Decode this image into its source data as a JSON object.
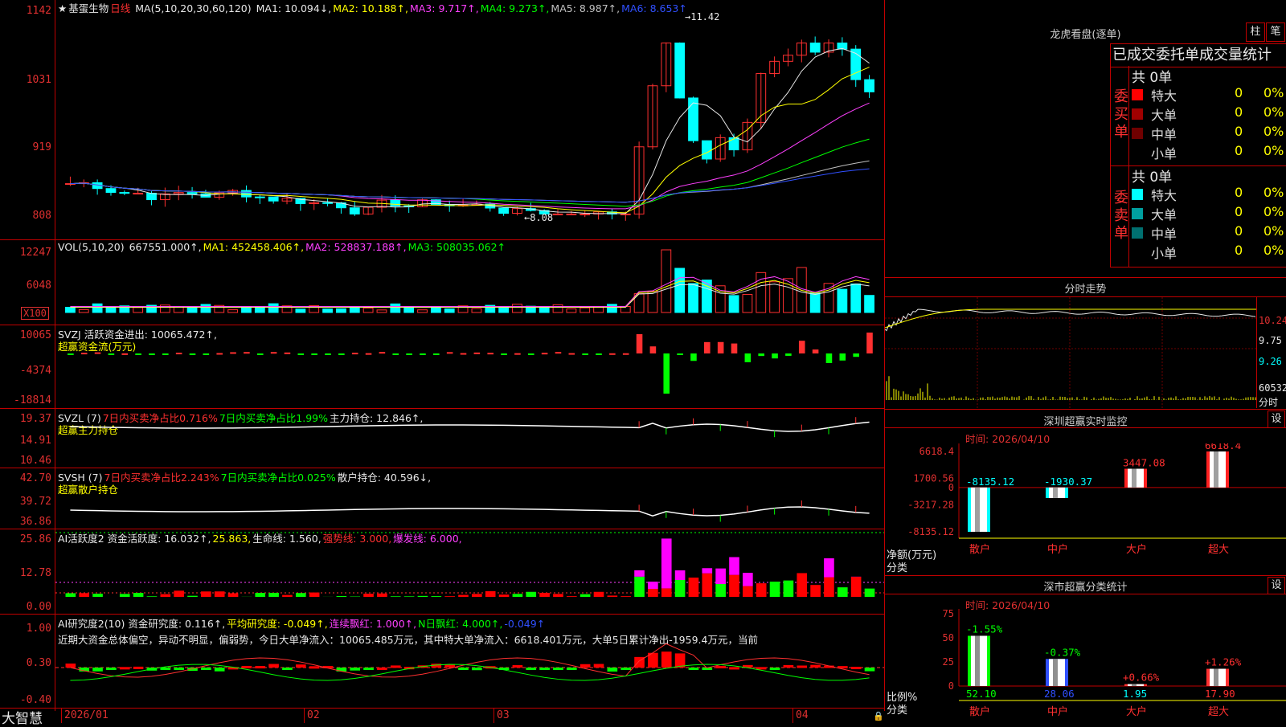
{
  "stock": {
    "star": "★",
    "name": "基蛋生物",
    "period": "日线"
  },
  "main_indicator": {
    "label": "MA(5,10,20,30,60,120)",
    "items": [
      {
        "text": "MA1: 10.094↓,",
        "color": "#e8e8e8"
      },
      {
        "text": "MA2: 10.188↑,",
        "color": "#ffff00"
      },
      {
        "text": "MA3: 9.717↑,",
        "color": "#ff40ff"
      },
      {
        "text": "MA4: 9.273↑,",
        "color": "#00ff00"
      },
      {
        "text": "MA5: 8.987↑,",
        "color": "#c0c0c0"
      },
      {
        "text": "MA6: 8.653↑",
        "color": "#3050ff"
      }
    ],
    "high_mark": "11.42",
    "low_mark": "8.08",
    "y_labels": [
      "1142",
      "1031",
      "919",
      "808"
    ]
  },
  "volume_panel": {
    "label": "VOL(5,10,20)",
    "items": [
      {
        "text": "667551.000↑,",
        "color": "#e8e8e8"
      },
      {
        "text": "MA1: 452458.406↑,",
        "color": "#ffff00"
      },
      {
        "text": "MA2: 528837.188↑,",
        "color": "#ff40ff"
      },
      {
        "text": "MA3: 508035.062↑",
        "color": "#00ff00"
      }
    ],
    "y_labels": [
      "12247",
      "6048"
    ],
    "unit_box": "X100"
  },
  "svzj_panel": {
    "line1": "SVZJ  活跃资金进出: 10065.472↑,",
    "line2": "超赢资金流(万元)",
    "y_labels": [
      "10065",
      "-4374",
      "-18814"
    ]
  },
  "svzl_panel": {
    "label": "SVZL (7)",
    "items": [
      {
        "text": "7日内买卖净占比0.716%",
        "color": "#ff3030"
      },
      {
        "text": "7日内买卖净占比1.99%",
        "color": "#00ff00"
      },
      {
        "text": "主力持仓: 12.846↑,",
        "color": "#e8e8e8"
      }
    ],
    "line2": "超赢主力持仓",
    "y_labels": [
      "19.37",
      "14.91",
      "10.46"
    ]
  },
  "svsh_panel": {
    "label": "SVSH (7)",
    "items": [
      {
        "text": "7日内买卖净占比2.243%",
        "color": "#ff3030"
      },
      {
        "text": "7日内买卖净占比0.025%",
        "color": "#00ff00"
      },
      {
        "text": "散户持仓: 40.596↓,",
        "color": "#e8e8e8"
      }
    ],
    "line2": "超赢散户持仓",
    "y_labels": [
      "42.70",
      "39.72",
      "36.86"
    ]
  },
  "ai_active_panel": {
    "items": [
      {
        "text": "AI活跃度2 资金活跃度: 16.032↑,",
        "color": "#e8e8e8"
      },
      {
        "text": "25.863,",
        "color": "#ffff00"
      },
      {
        "text": "生命线: 1.560,",
        "color": "#e8e8e8"
      },
      {
        "text": "强势线: 3.000,",
        "color": "#ff3030"
      },
      {
        "text": "爆发线: 6.000,",
        "color": "#ff40ff"
      }
    ],
    "y_labels": [
      "25.86",
      "12.78",
      "0.00"
    ]
  },
  "ai_research_panel": {
    "items": [
      {
        "text": "AI研究度2(10) 资金研究度: 0.116↑,",
        "color": "#e8e8e8"
      },
      {
        "text": "平均研究度: -0.049↑,",
        "color": "#ffff00"
      },
      {
        "text": "连续飘红: 1.000↑,",
        "color": "#ff40ff"
      },
      {
        "text": "N日飘红: 4.000↑,",
        "color": "#00ff00"
      },
      {
        "text": "-0.049↑",
        "color": "#3050ff"
      }
    ],
    "line2": "近期大资金总体偏空，异动不明显，偏弱势，今日大单净流入：10065.485万元，其中特大单净流入：6618.401万元，大单5日累计净出-1959.4万元，当前",
    "y_labels": [
      "1.00",
      "0.30",
      "-0.40"
    ]
  },
  "bottom_bar": {
    "brand": "大智慧",
    "dates": [
      "2026/01",
      "02",
      "03",
      "04"
    ]
  },
  "right_top": {
    "title": "龙虎看盘(逐单)",
    "tab_zhu": "柱",
    "tab_bi": "笔",
    "header": "已成交委托单成交量统计",
    "buy": {
      "count": "共 0单",
      "side": "委买单",
      "rows": [
        {
          "label": "特大",
          "value": "0",
          "pct": "0%",
          "color": "#ff0000"
        },
        {
          "label": "大单",
          "value": "0",
          "pct": "0%",
          "color": "#a00000"
        },
        {
          "label": "中单",
          "value": "0",
          "pct": "0%",
          "color": "#700000"
        },
        {
          "label": "小单",
          "value": "0",
          "pct": "0%",
          "color": "#000000"
        }
      ]
    },
    "sell": {
      "count": "共 0单",
      "side": "委卖单",
      "rows": [
        {
          "label": "特大",
          "value": "0",
          "pct": "0%",
          "color": "#00ffff"
        },
        {
          "label": "大单",
          "value": "0",
          "pct": "0%",
          "color": "#00a0a0"
        },
        {
          "label": "中单",
          "value": "0",
          "pct": "0%",
          "color": "#007070"
        },
        {
          "label": "小单",
          "value": "0",
          "pct": "0%",
          "color": "#000000"
        }
      ]
    }
  },
  "intraday": {
    "title": "分时走势",
    "y_labels": [
      "10.24",
      "9.75",
      "9.26",
      "60532",
      "分时"
    ]
  },
  "monitor": {
    "title": "深圳超赢实时监控",
    "settings": "设",
    "time": "时间: 2026/04/10",
    "y_labels": [
      "6618.4",
      "1700.56",
      "0",
      "-3217.28",
      "-8135.12"
    ],
    "unit_line1": "净额(万元)",
    "unit_line2": "分类",
    "categories": [
      "散户",
      "中户",
      "大户",
      "超大"
    ]
  },
  "classify": {
    "title": "深市超赢分类统计",
    "settings": "设",
    "time": "时间: 2026/04/10",
    "y_labels": [
      "75",
      "50",
      "25",
      "0"
    ],
    "unit_line1": "比例%",
    "unit_line2": "分类",
    "categories": [
      "散户",
      "中户",
      "大户",
      "超大"
    ]
  },
  "chart_data": [
    {
      "type": "bar",
      "title": "深圳超赢实时监控",
      "ylabel": "净额(万元)",
      "categories": [
        "散户",
        "中户",
        "大户",
        "超大"
      ],
      "values": [
        -8135.12,
        -1930.37,
        3447.08,
        6618.4
      ],
      "value_labels": [
        "-8135.12",
        "-1930.37",
        "3447.08",
        "6618.4"
      ],
      "ylim": [
        -8135.12,
        6618.4
      ]
    },
    {
      "type": "bar",
      "title": "深市超赢分类统计",
      "ylabel": "比例%",
      "categories": [
        "散户",
        "中户",
        "大户",
        "超大"
      ],
      "values": [
        52.1,
        28.06,
        1.95,
        17.9
      ],
      "value_labels": [
        "52.10",
        "28.06",
        "1.95",
        "17.90"
      ],
      "change_labels": [
        "-1.55%",
        "-0.37%",
        "+0.66%",
        "+1.26%"
      ],
      "ylim": [
        0,
        75
      ]
    }
  ]
}
